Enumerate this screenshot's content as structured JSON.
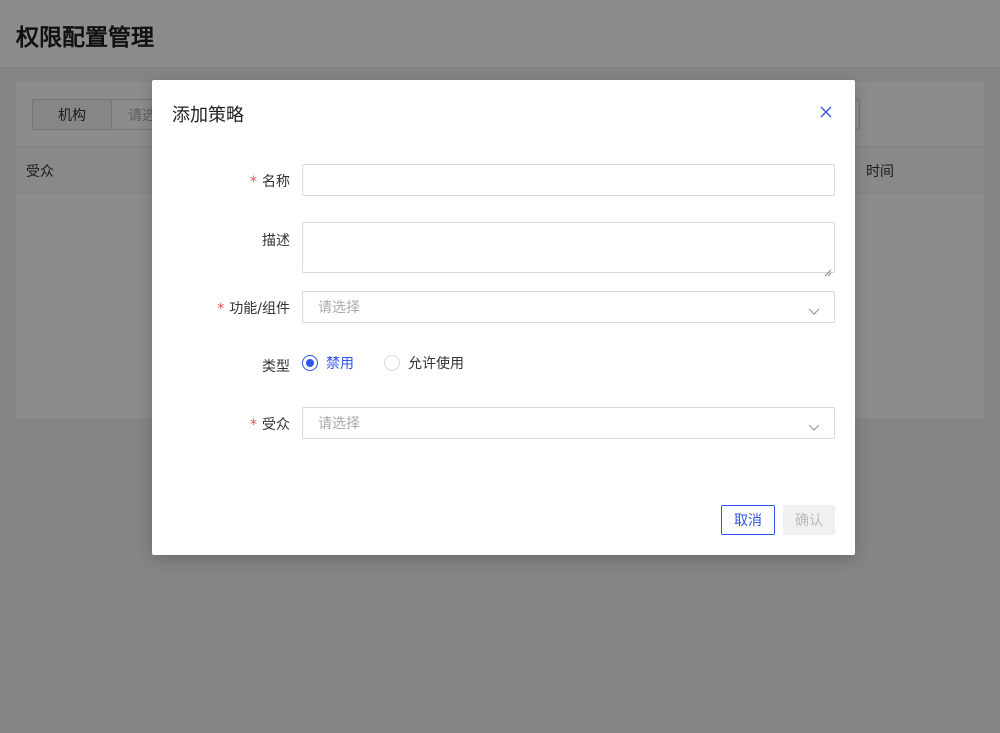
{
  "page": {
    "title": "权限配置管理",
    "filter_label": "机构",
    "filter_placeholder": "请选",
    "col_audience": "受众",
    "col_time": "时间"
  },
  "modal": {
    "title": "添加策略",
    "fields": {
      "name_label": "名称",
      "name_value": "",
      "desc_label": "描述",
      "desc_value": "",
      "func_label": "功能/组件",
      "func_placeholder": "请选择",
      "type_label": "类型",
      "type_options": [
        "禁用",
        "允许使用"
      ],
      "type_selected": "禁用",
      "audience_label": "受众",
      "audience_placeholder": "请选择"
    },
    "required_mark": "*",
    "buttons": {
      "cancel": "取消",
      "confirm": "确认"
    }
  },
  "colors": {
    "accent": "#2f54eb",
    "required": "#e34d59",
    "mask": "rgba(0,0,0,0.45)"
  },
  "icons": {
    "close": "close-icon",
    "dropdown": "chevron-down-icon"
  }
}
